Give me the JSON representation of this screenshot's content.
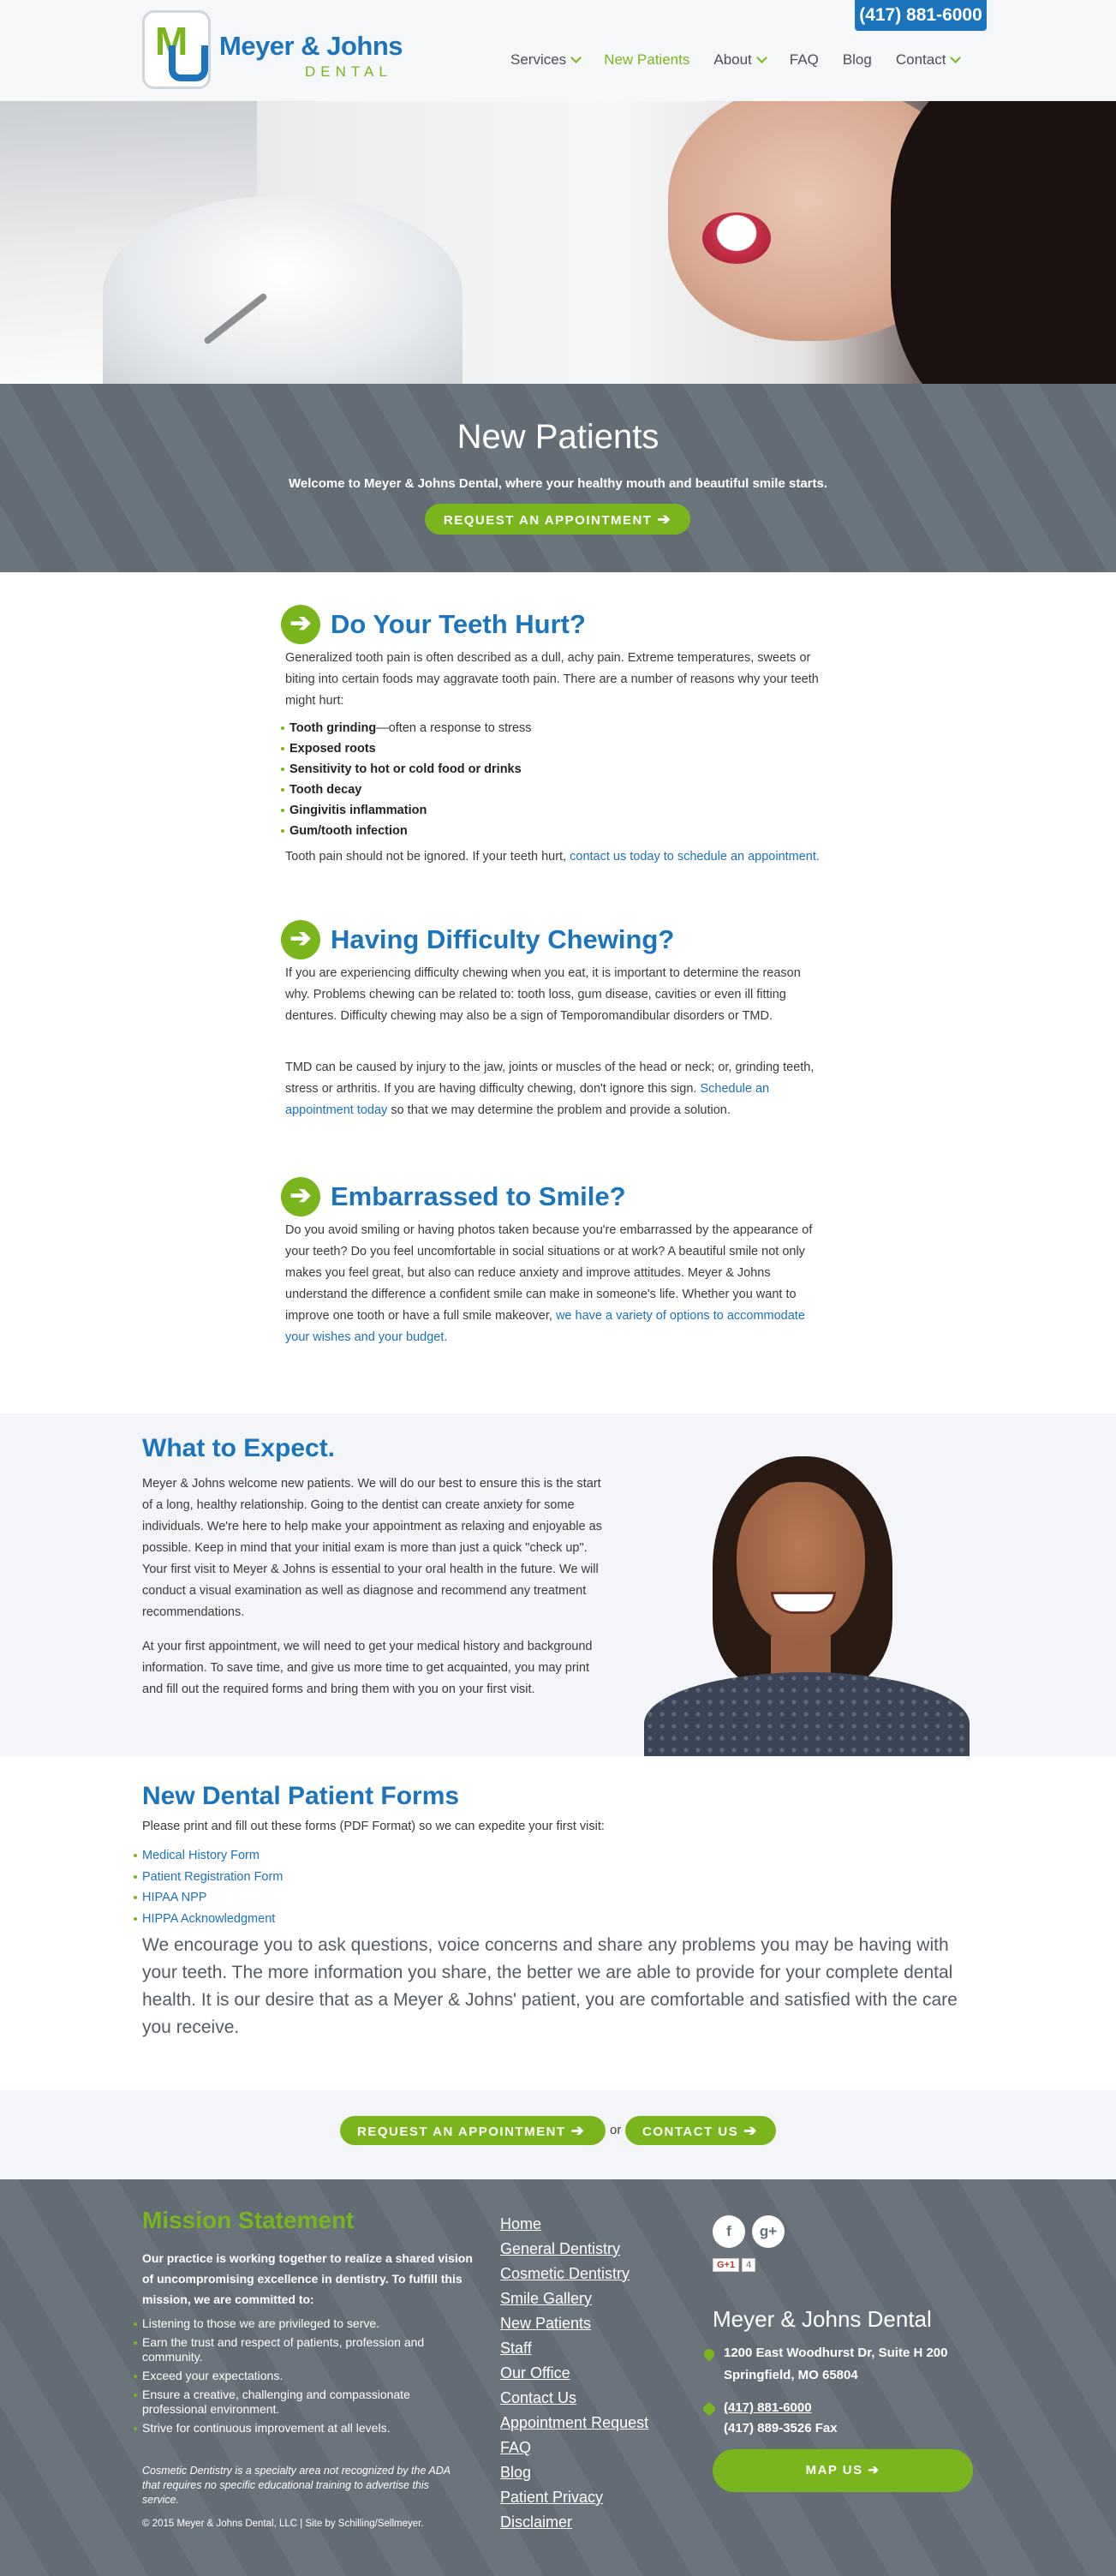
{
  "header": {
    "phone": "(417) 881-6000",
    "logo_name": "Meyer & Johns",
    "logo_sub": "DENTAL",
    "nav": [
      {
        "label": "Services",
        "dropdown": true
      },
      {
        "label": "New Patients",
        "dropdown": false,
        "active": true
      },
      {
        "label": "About",
        "dropdown": true
      },
      {
        "label": "FAQ",
        "dropdown": false
      },
      {
        "label": "Blog",
        "dropdown": false
      },
      {
        "label": "Contact",
        "dropdown": true
      }
    ]
  },
  "banner": {
    "title": "New Patients",
    "subtitle": "Welcome to Meyer & Johns Dental, where your healthy mouth and beautiful smile starts.",
    "button": "REQUEST AN APPOINTMENT"
  },
  "teeth": {
    "title": "Do Your Teeth Hurt?",
    "intro": "Generalized tooth pain is often described as a dull, achy pain. Extreme temperatures, sweets or biting into certain foods may aggravate tooth pain. There are a number of reasons why your teeth might hurt:",
    "items": [
      {
        "bold": "Tooth grinding",
        "rest": "—often a response to stress"
      },
      {
        "bold": "Exposed roots",
        "rest": ""
      },
      {
        "bold": "Sensitivity to hot or cold food or drinks",
        "rest": ""
      },
      {
        "bold": "Tooth decay",
        "rest": ""
      },
      {
        "bold": "Gingivitis inflammation",
        "rest": ""
      },
      {
        "bold": "Gum/tooth infection",
        "rest": ""
      }
    ],
    "outro": "Tooth pain should not be ignored. If your teeth hurt, ",
    "outro_link": "contact us today to schedule an appointment."
  },
  "chewing": {
    "title": "Having Difficulty Chewing?",
    "p1": "If you are experiencing difficulty chewing when you eat, it is important to determine the reason why. Problems chewing can be related to: tooth loss, gum disease, cavities or even ill fitting dentures. Difficulty chewing may also be a sign of Temporomandibular disorders or TMD.",
    "p2_a": "TMD can be caused by injury to the jaw, joints or muscles of the head or neck; or, grinding teeth, stress or arthritis. If you are having difficulty chewing, don't ignore this sign. ",
    "p2_link": "Schedule an appointment today",
    "p2_b": " so that we may determine the problem and provide a solution."
  },
  "smile": {
    "title": "Embarrassed to Smile?",
    "p1": "Do you avoid smiling or having photos taken because you're embarrassed by the appearance of your teeth? Do you feel uncomfortable in social situations or at work? A beautiful smile not only makes you feel great, but also can reduce anxiety and improve attitudes. Meyer & Johns understand the difference a confident smile can make in someone's life. Whether you want to improve one tooth or have a full smile makeover, ",
    "p1_link": "we have a variety of options to accommodate your wishes and your budget."
  },
  "expect": {
    "title": "What to Expect.",
    "p1": "Meyer & Johns welcome new patients. We will do our best to ensure this is the start of a long, healthy relationship. Going to the dentist can create anxiety for some individuals. We're here to help make your appointment as relaxing and enjoyable as possible. Keep in mind that your initial exam is more than just a quick \"check up\". Your first visit to Meyer & Johns is essential to your oral health in the future. We will conduct a visual examination as well as diagnose and recommend any treatment recommendations.",
    "p2": "At your first appointment, we will need to get your medical history and background information. To save time, and give us more time to get acquainted, you may print and fill out the required forms and bring them with you on your first visit."
  },
  "forms": {
    "title": "New Dental Patient Forms",
    "intro": "Please print and fill out these forms (PDF Format) so we can expedite your first visit:",
    "links": [
      "Medical History Form",
      "Patient Registration Form",
      "HIPAA NPP",
      "HIPPA Acknowledgment"
    ],
    "closing": "We encourage you to ask questions, voice concerns and share any problems you may be having with your teeth. The more information you share, the better we are able to provide for your complete dental health. It is our desire that as a Meyer & Johns' patient, you are comfortable and satisfied with the care you receive."
  },
  "cta": {
    "appointment": "REQUEST AN APPOINTMENT",
    "or": "or",
    "contact": "CONTACT US"
  },
  "footer": {
    "mission_title": "Mission Statement",
    "mission_lead": "Our practice is working together to realize a shared vision of uncompromising excellence in dentistry. To fulfill this mission, we are committed to:",
    "mission_items": [
      "Listening to those we are privileged to serve.",
      "Earn the trust and respect of patients, profession and community.",
      "Exceed your expectations.",
      "Ensure a creative, challenging and compassionate professional environment.",
      "Strive for continuous improvement at all levels."
    ],
    "disclaimer": "Cosmetic Dentistry is a specialty area not recognized by the ADA that requires no specific educational training to advertise this service.",
    "copyright": "© 2015 Meyer & Johns Dental, LLC | Site by Schilling/Sellmeyer.",
    "links": [
      "Home",
      "General Dentistry",
      "Cosmetic Dentistry",
      "Smile Gallery",
      "New Patients",
      "Staff",
      "Our Office",
      "Contact Us",
      "Appointment Request",
      "FAQ",
      "Blog",
      "Patient Privacy",
      "Disclaimer"
    ],
    "social": {
      "facebook": "f",
      "gplus": "g+",
      "gplus_badge": "G+1",
      "gplus_count": "4"
    },
    "practice_name": "Meyer & Johns Dental",
    "address1": "1200 East Woodhurst Dr, Suite H 200",
    "address2": "Springfield, MO 65804",
    "phone": "(417) 881-6000",
    "fax": "(417) 889-3526 Fax",
    "map_button": "MAP US"
  },
  "colors": {
    "brand_blue": "#1c74bc",
    "brand_green": "#7ab51d",
    "slate": "#667079"
  }
}
